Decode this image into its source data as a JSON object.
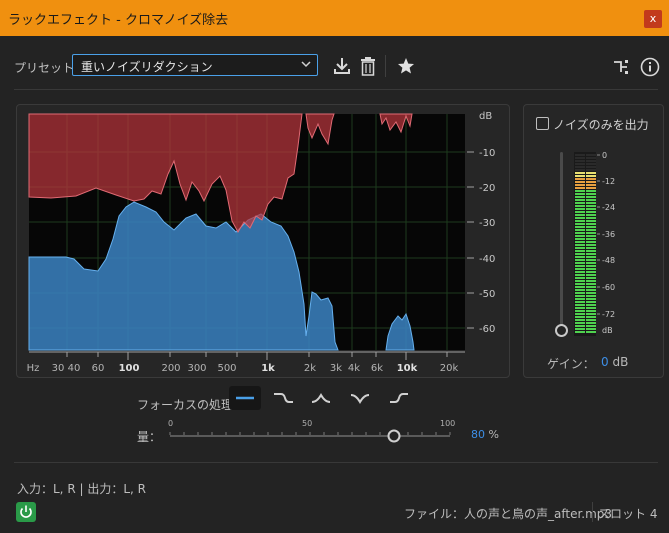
{
  "window": {
    "title": "ラックエフェクト - クロマノイズ除去",
    "close_label": "x"
  },
  "preset": {
    "label": "プリセット：",
    "value": "重いノイズリダクション"
  },
  "icons": [
    "download-icon",
    "trash-icon",
    "star-icon",
    "routing-icon",
    "info-icon",
    "chevron-down-icon",
    "power-icon"
  ],
  "graph": {
    "db_labels": [
      "dB",
      "-10",
      "-20",
      "-30",
      "-40",
      "-50",
      "-60"
    ],
    "freq_labels": [
      "Hz",
      "30",
      "40",
      "60",
      "100",
      "200",
      "300",
      "500",
      "1k",
      "2k",
      "3k",
      "4k",
      "6k",
      "10k",
      "20k"
    ],
    "colors": {
      "noise_red": "#c0393f",
      "signal_blue": "#3f86c4",
      "background": "#060606",
      "grid": "#1e3a1e"
    }
  },
  "output_panel": {
    "noise_only_label": "ノイズのみを出力",
    "noise_only_checked": false,
    "meter_labels": [
      "0",
      "-12",
      "-24",
      "-36",
      "-48",
      "-60",
      "-72",
      "dB"
    ],
    "gain_label": "ゲイン：",
    "gain_value": "0",
    "gain_unit": "dB"
  },
  "focus": {
    "label": "フォーカスの処理：",
    "modes": [
      "flat",
      "low",
      "mid",
      "notch",
      "high"
    ],
    "selected": "flat"
  },
  "amount": {
    "label": "量：",
    "ticks": [
      "0",
      "50",
      "100"
    ],
    "value": "80",
    "unit": "%",
    "fraction": 0.8
  },
  "footer": {
    "io": "入力：L, R | 出力：L, R",
    "file": "ファイル：人の声と鳥の声_after.mp3",
    "slot": "スロット 4"
  }
}
